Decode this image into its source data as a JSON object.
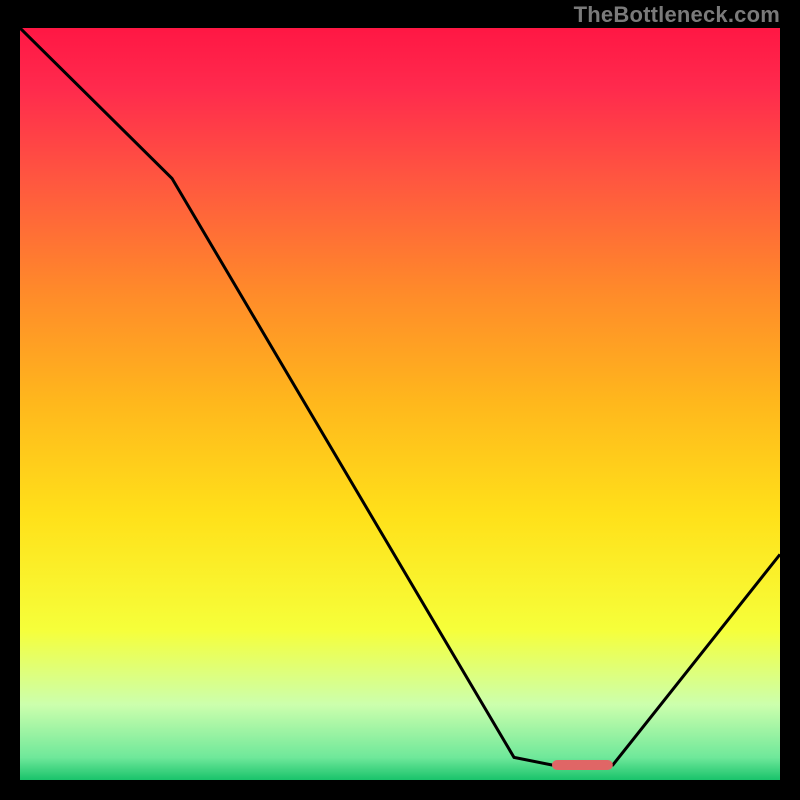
{
  "watermark": "TheBottleneck.com",
  "chart_data": {
    "type": "line",
    "title": "",
    "xlabel": "",
    "ylabel": "",
    "xlim": [
      0,
      100
    ],
    "ylim": [
      0,
      100
    ],
    "series": [
      {
        "name": "bottleneck-curve",
        "x": [
          0,
          20,
          65,
          70,
          78,
          100
        ],
        "values": [
          100,
          80,
          3,
          2,
          2,
          30
        ]
      }
    ],
    "marker": {
      "name": "target-marker",
      "x_start": 70,
      "x_end": 78,
      "y": 2,
      "color": "#e06666"
    },
    "background_gradient": {
      "stops": [
        {
          "offset": 0.0,
          "color": "#ff1744"
        },
        {
          "offset": 0.08,
          "color": "#ff2a4d"
        },
        {
          "offset": 0.2,
          "color": "#ff5640"
        },
        {
          "offset": 0.35,
          "color": "#ff8a2a"
        },
        {
          "offset": 0.5,
          "color": "#ffb81c"
        },
        {
          "offset": 0.65,
          "color": "#ffe11a"
        },
        {
          "offset": 0.8,
          "color": "#f6ff3a"
        },
        {
          "offset": 0.9,
          "color": "#ccffad"
        },
        {
          "offset": 0.97,
          "color": "#6fe89a"
        },
        {
          "offset": 1.0,
          "color": "#19c36b"
        }
      ]
    }
  }
}
